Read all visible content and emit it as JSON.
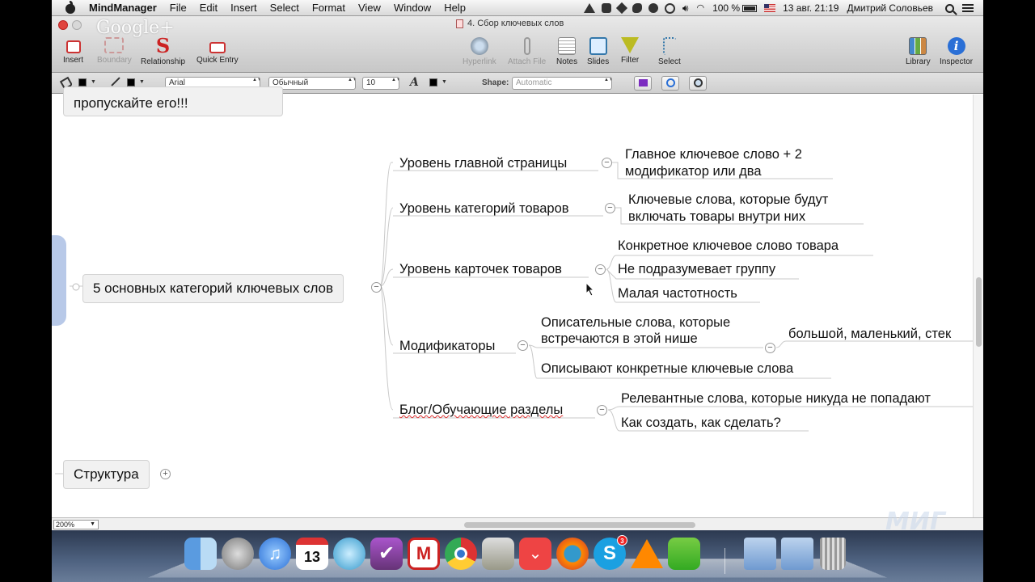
{
  "menubar": {
    "app_name": "MindManager",
    "items": [
      "File",
      "Edit",
      "Insert",
      "Select",
      "Format",
      "View",
      "Window",
      "Help"
    ],
    "battery": "100 %",
    "datetime": "13 авг. 21:19",
    "user": "Дмитрий Соловьев"
  },
  "window": {
    "title": "4. Сбор ключевых слов",
    "overlay_logo": "Google+"
  },
  "toolbar": {
    "insert": "Insert",
    "boundary": "Boundary",
    "relationship": "Relationship",
    "quick_entry": "Quick Entry",
    "hyperlink": "Hyperlink",
    "attach_file": "Attach File",
    "notes": "Notes",
    "slides": "Slides",
    "filter": "Filter",
    "select": "Select",
    "library": "Library",
    "inspector": "Inspector"
  },
  "formatbar": {
    "font": "Arial",
    "style": "Обычный",
    "size": "10",
    "shape_label": "Shape:",
    "shape_value": "Automatic"
  },
  "map": {
    "partial_top": "пропускайте его!!!",
    "central": "5 основных категорий ключевых слов",
    "branches": [
      {
        "label": "Уровень главной страницы",
        "children": [
          "Главное ключевое слово + 2",
          "модификатор или два"
        ]
      },
      {
        "label": "Уровень категорий товаров",
        "children": [
          "Ключевые слова, которые будут",
          "включать товары внутри них"
        ]
      },
      {
        "label": "Уровень карточек товаров",
        "children": [
          "Конкретное ключевое слово товара",
          "Не подразумевает группу",
          "Малая частотность"
        ]
      },
      {
        "label": "Модификаторы",
        "children": [
          "Описательные слова, которые",
          "встречаются в этой нише",
          "Описывают конкретные ключевые слова"
        ],
        "grandchild": "большой, маленький, стек"
      },
      {
        "label": "Блог/Обучающие разделы",
        "children": [
          "Релевантные слова, которые никуда не попадают",
          "Как создать, как сделать?"
        ]
      }
    ],
    "structure": "Структура"
  },
  "statusbar": {
    "zoom": "200%"
  },
  "dock": {
    "calendar_day": "13",
    "skype_badge": "3",
    "mail_letter": "M"
  },
  "watermark": "МИГ"
}
